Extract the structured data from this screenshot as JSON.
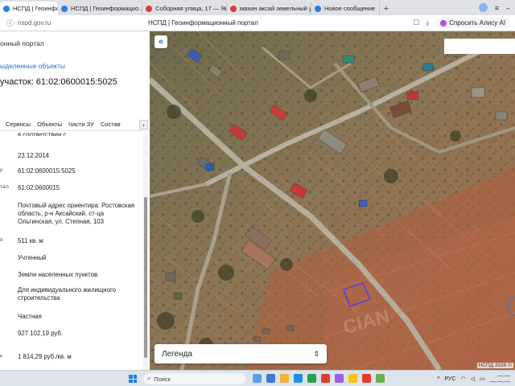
{
  "tabs": [
    {
      "label": "НСПД | Геоинформаци…",
      "active": true,
      "favicon_color": "#2a7de1"
    },
    {
      "label": "НСПД | Геоинформацио…",
      "active": false,
      "favicon_color": "#2a7de1"
    },
    {
      "label": "Соборная улица, 17 — Ян…",
      "active": false,
      "favicon_color": "#e53935"
    },
    {
      "label": "махин аксай земельный у…",
      "active": false,
      "favicon_color": "#e53935"
    },
    {
      "label": "Новое сообщение",
      "active": false,
      "favicon_color": "#2a7de1"
    }
  ],
  "address_bar": {
    "url": "nspd.gov.ru",
    "page_title": "НСПД | Геоинформационный портал",
    "assistant_label": "Спросить Алису AI"
  },
  "panel": {
    "portal_label": "онный портал",
    "selected_link": "ыделенные объекты",
    "heading": "участок: 61:02:0600015:5025",
    "tabs": [
      "Сервисы",
      "Объекты",
      "Части ЗУ",
      "Состав"
    ],
    "rows": [
      {
        "label": "",
        "value": "23.12.2014"
      },
      {
        "label": "р",
        "value": "61:02:0600015:5025"
      },
      {
        "label": "тал",
        "value": "61:02:0600015"
      },
      {
        "label": "",
        "value": "Почтовый адрес ориентира: Ростовская область, р-н Аксайский, ст-ца Ольгинская, ул. Степная, 103"
      },
      {
        "label": "я",
        "value": "511 кв. м"
      },
      {
        "label": "",
        "value": "Учтенный"
      },
      {
        "label": "",
        "value": "Земли населенных пунктов"
      },
      {
        "label": "",
        "value": "Для индивидуального жилищного строительства"
      },
      {
        "label": "",
        "value": "Частная"
      },
      {
        "label": "",
        "value": "927 102,19 руб."
      },
      {
        "label": "ь",
        "value": "1 814,29 руб./кв. м"
      }
    ]
  },
  "map": {
    "legend_label": "Легенда",
    "attribution": "НСПД 2026 ©",
    "watermark": "CIAN",
    "parcel_color": "#4b3cff"
  },
  "taskbar": {
    "search_placeholder": "Поиск",
    "lang": "РУС",
    "app_colors": [
      "#5aa1e8",
      "#3d7bd8",
      "#f2b23a",
      "#1f8fe6",
      "#2e9e48",
      "#d8402e",
      "#9b5de5",
      "#f5c518",
      "#e53935",
      "#6ab04c"
    ]
  }
}
